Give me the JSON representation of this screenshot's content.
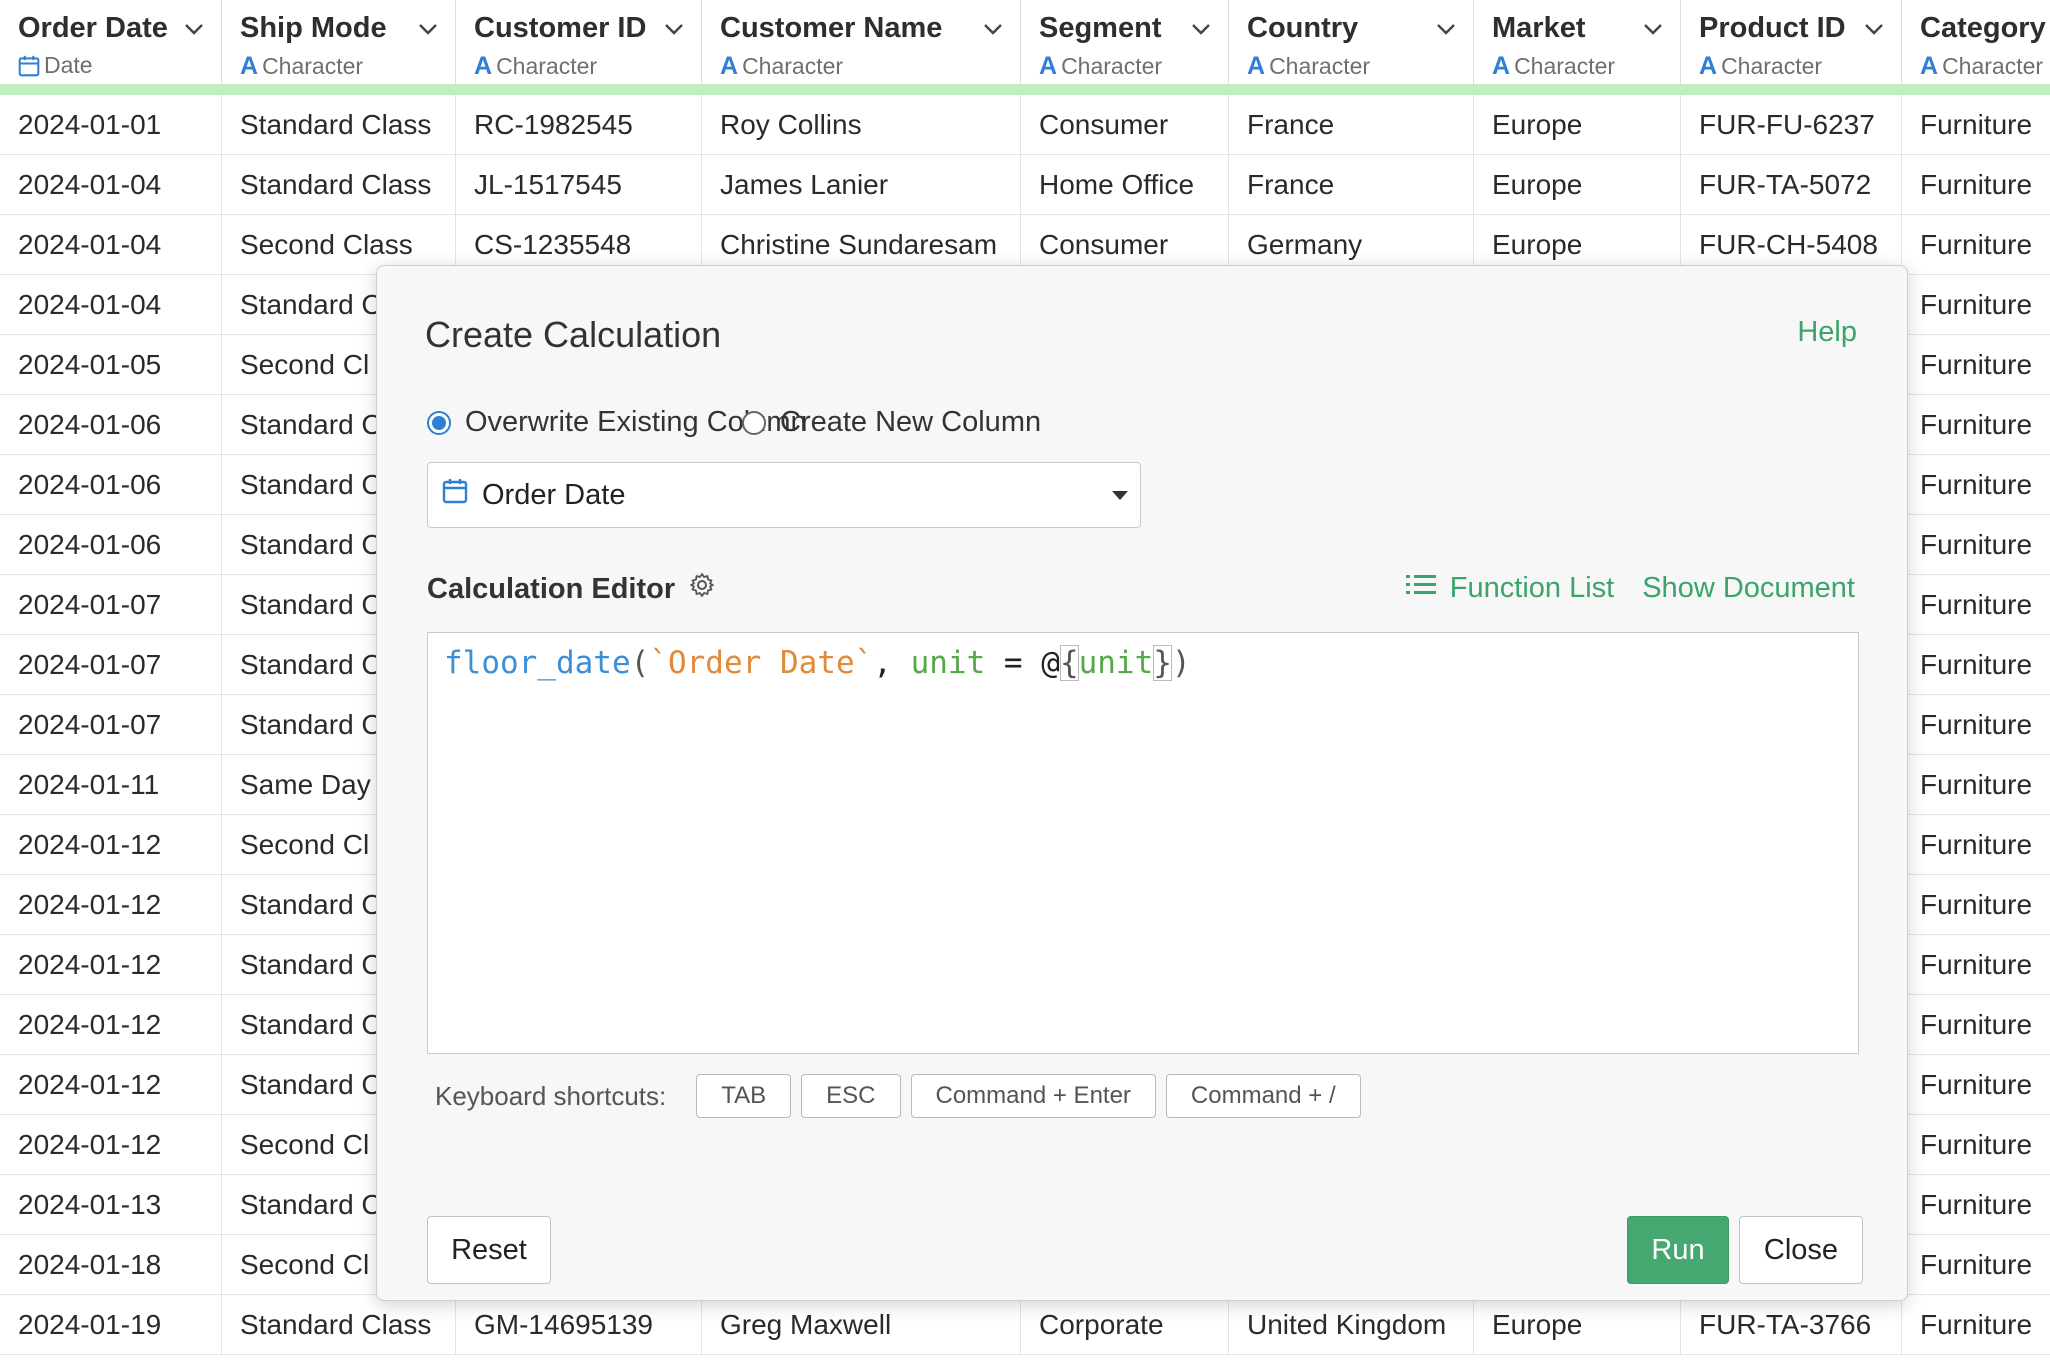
{
  "grid": {
    "columns": [
      {
        "name": "Order Date",
        "type": "Date",
        "type_icon": "calendar-icon"
      },
      {
        "name": "Ship Mode",
        "type": "Character",
        "type_icon": "character-icon"
      },
      {
        "name": "Customer ID",
        "type": "Character",
        "type_icon": "character-icon"
      },
      {
        "name": "Customer Name",
        "type": "Character",
        "type_icon": "character-icon"
      },
      {
        "name": "Segment",
        "type": "Character",
        "type_icon": "character-icon"
      },
      {
        "name": "Country",
        "type": "Character",
        "type_icon": "character-icon"
      },
      {
        "name": "Market",
        "type": "Character",
        "type_icon": "character-icon"
      },
      {
        "name": "Product ID",
        "type": "Character",
        "type_icon": "character-icon"
      },
      {
        "name": "Category",
        "type": "Character",
        "type_icon": "character-icon"
      }
    ],
    "rows": [
      [
        "2024-01-01",
        "Standard Class",
        "RC-1982545",
        "Roy Collins",
        "Consumer",
        "France",
        "Europe",
        "FUR-FU-6237",
        "Furniture"
      ],
      [
        "2024-01-04",
        "Standard Class",
        "JL-1517545",
        "James Lanier",
        "Home Office",
        "France",
        "Europe",
        "FUR-TA-5072",
        "Furniture"
      ],
      [
        "2024-01-04",
        "Second Class",
        "CS-1235548",
        "Christine Sundaresam",
        "Consumer",
        "Germany",
        "Europe",
        "FUR-CH-5408",
        "Furniture"
      ],
      [
        "2024-01-04",
        "Standard C",
        "",
        "",
        "",
        "",
        "",
        "",
        "Furniture"
      ],
      [
        "2024-01-05",
        "Second Cl",
        "",
        "",
        "",
        "",
        "",
        "",
        "Furniture"
      ],
      [
        "2024-01-06",
        "Standard C",
        "",
        "",
        "",
        "",
        "",
        "",
        "Furniture"
      ],
      [
        "2024-01-06",
        "Standard C",
        "",
        "",
        "",
        "",
        "",
        "",
        "Furniture"
      ],
      [
        "2024-01-06",
        "Standard C",
        "",
        "",
        "",
        "",
        "",
        "",
        "Furniture"
      ],
      [
        "2024-01-07",
        "Standard C",
        "",
        "",
        "",
        "",
        "",
        "",
        "Furniture"
      ],
      [
        "2024-01-07",
        "Standard C",
        "",
        "",
        "",
        "",
        "",
        "",
        "Furniture"
      ],
      [
        "2024-01-07",
        "Standard C",
        "",
        "",
        "",
        "",
        "",
        "",
        "Furniture"
      ],
      [
        "2024-01-11",
        "Same Day",
        "",
        "",
        "",
        "",
        "",
        "",
        "Furniture"
      ],
      [
        "2024-01-12",
        "Second Cl",
        "",
        "",
        "",
        "",
        "",
        "",
        "Furniture"
      ],
      [
        "2024-01-12",
        "Standard C",
        "",
        "",
        "",
        "",
        "",
        "",
        "Furniture"
      ],
      [
        "2024-01-12",
        "Standard C",
        "",
        "",
        "",
        "",
        "",
        "",
        "Furniture"
      ],
      [
        "2024-01-12",
        "Standard C",
        "",
        "",
        "",
        "",
        "",
        "",
        "Furniture"
      ],
      [
        "2024-01-12",
        "Standard C",
        "",
        "",
        "",
        "",
        "",
        "",
        "Furniture"
      ],
      [
        "2024-01-12",
        "Second Cl",
        "",
        "",
        "",
        "",
        "",
        "",
        "Furniture"
      ],
      [
        "2024-01-13",
        "Standard C",
        "",
        "",
        "",
        "",
        "",
        "",
        "Furniture"
      ],
      [
        "2024-01-18",
        "Second Cl",
        "",
        "",
        "",
        "",
        "",
        "",
        "Furniture"
      ],
      [
        "2024-01-19",
        "Standard Class",
        "GM-14695139",
        "Greg Maxwell",
        "Corporate",
        "United Kingdom",
        "Europe",
        "FUR-TA-3766",
        "Furniture"
      ]
    ]
  },
  "modal": {
    "title": "Create Calculation",
    "help_label": "Help",
    "radio_overwrite": "Overwrite Existing Column",
    "radio_new": "Create New Column",
    "selected_option": "overwrite",
    "column_select_value": "Order Date",
    "editor_label": "Calculation Editor",
    "function_list_label": "Function List",
    "show_document_label": "Show Document",
    "code": {
      "fn": "floor_date",
      "open": "(",
      "str": "`Order Date`",
      "comma": ", ",
      "arg": "unit",
      "eq": " = ",
      "at": "@",
      "lbrace": "{",
      "param": "unit",
      "rbrace": "}",
      "close": ")"
    },
    "shortcuts_label": "Keyboard shortcuts:",
    "shortcuts": [
      "TAB",
      "ESC",
      "Command + Enter",
      "Command + /"
    ],
    "reset_label": "Reset",
    "run_label": "Run",
    "close_label": "Close"
  },
  "colors": {
    "accent_green": "#45a870",
    "link_green": "#3aa46b",
    "type_blue": "#2f7fd6",
    "header_strip": "#bfeebf"
  }
}
